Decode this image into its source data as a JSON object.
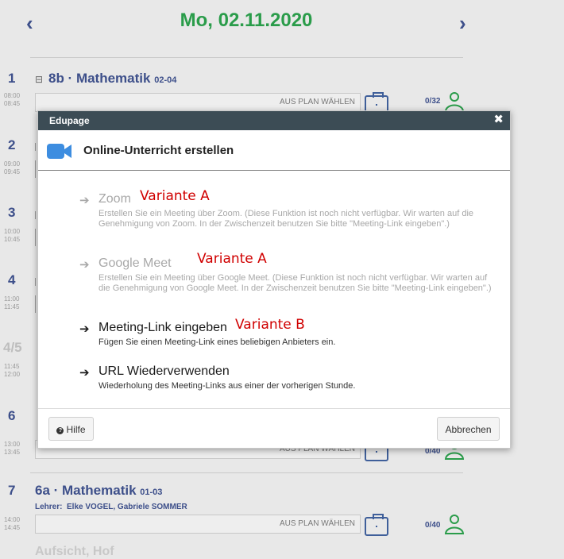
{
  "header": {
    "date": "Mo, 02.11.2020",
    "prev_icon": "chevron-left-icon",
    "next_icon": "chevron-right-icon"
  },
  "schedule": {
    "p1": {
      "num": "1",
      "start": "08:00",
      "end": "08:45",
      "subject": "8b · Mathematik",
      "room": "02-04",
      "collapse": "⊟",
      "plan_label": "AUS PLAN WÄHLEN",
      "count": "0/32"
    },
    "p2": {
      "num": "2",
      "start": "09:00",
      "end": "09:45"
    },
    "p3": {
      "num": "3",
      "start": "10:00",
      "end": "10:45"
    },
    "p4": {
      "num": "4",
      "start": "11:00",
      "end": "11:45"
    },
    "p45": {
      "num": "4/5",
      "start": "11:45",
      "end": "12:00"
    },
    "p6": {
      "num": "6",
      "start": "13:00",
      "end": "13:45",
      "plan_label": "AUS PLAN WÄHLEN",
      "count": "0/40"
    },
    "p7": {
      "num": "7",
      "start": "14:00",
      "end": "14:45",
      "subject": "6a · Mathematik",
      "room": "01-03",
      "teacher_label": "Lehrer:",
      "teachers": "Elke VOGEL, Gabriele SOMMER",
      "plan_label": "AUS PLAN WÄHLEN",
      "count": "0/40"
    },
    "footer_label": "Aufsicht, Hof"
  },
  "modal": {
    "bar_title": "Edupage",
    "close": "✖",
    "heading": "Online-Unterricht erstellen",
    "options": [
      {
        "title": "Zoom",
        "variant": "Variante A",
        "desc": "Erstellen Sie ein Meeting über Zoom. (Diese Funktion ist noch nicht verfügbar. Wir warten auf die Genehmigung von Zoom. In der Zwischenzeit benutzen Sie bitte \"Meeting-Link eingeben\".)"
      },
      {
        "title": "Google Meet",
        "variant": "Variante A",
        "desc": "Erstellen Sie ein Meeting über Google Meet. (Diese Funktion ist noch nicht verfügbar. Wir warten auf die Genehmigung von Google Meet. In der Zwischenzeit benutzen Sie bitte \"Meeting-Link eingeben\".)"
      },
      {
        "title": "Meeting-Link eingeben",
        "variant": "Variante B",
        "desc": "Fügen Sie einen Meeting-Link eines beliebigen Anbieters ein."
      },
      {
        "title": "URL Wiederverwenden",
        "desc": "Wiederholung des Meeting-Links aus einer der vorherigen Stunde."
      }
    ],
    "arrow": "➔",
    "help_button": "Hilfe",
    "cancel_button": "Abbrechen"
  },
  "colors": {
    "accent_green": "#2a9c4a",
    "accent_blue": "#3d4f8a",
    "modal_bar": "#3c4c55",
    "annotation_red": "#d00000"
  }
}
